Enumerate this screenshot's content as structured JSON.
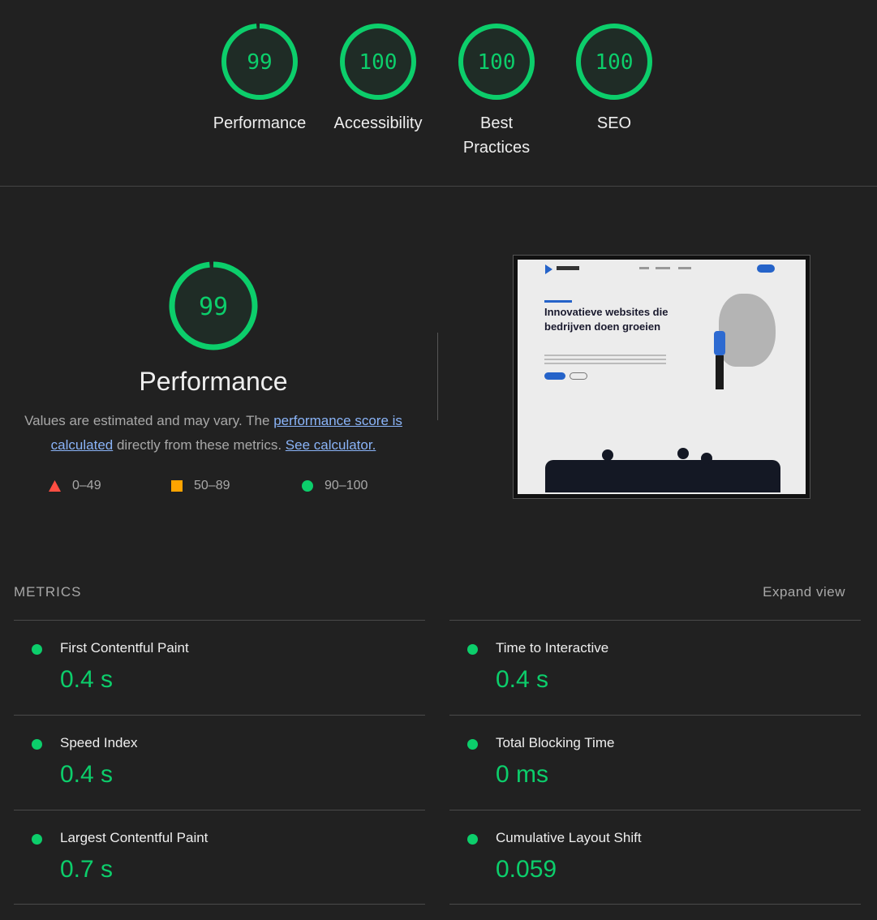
{
  "categories": [
    {
      "label": "Performance",
      "score": 99
    },
    {
      "label": "Accessibility",
      "score": 100
    },
    {
      "label": "Best Practices",
      "score": 100
    },
    {
      "label": "SEO",
      "score": 100
    }
  ],
  "performance": {
    "score": 99,
    "title": "Performance",
    "desc_1": "Values are estimated and may vary. The ",
    "link_score": "performance score is calculated",
    "desc_2": " directly from these metrics. ",
    "link_calc": "See calculator.",
    "legend": [
      {
        "range": "0–49",
        "color": "#ff4e42",
        "shape": "triangle"
      },
      {
        "range": "50–89",
        "color": "#ffa400",
        "shape": "square"
      },
      {
        "range": "90–100",
        "color": "#0cce6b",
        "shape": "circle"
      }
    ]
  },
  "thumbnail": {
    "headline": "Innovatieve websites die bedrijven doen groeien"
  },
  "metrics": {
    "header": "METRICS",
    "expand": "Expand view",
    "items": [
      {
        "label": "First Contentful Paint",
        "value": "0.4 s"
      },
      {
        "label": "Time to Interactive",
        "value": "0.4 s"
      },
      {
        "label": "Speed Index",
        "value": "0.4 s"
      },
      {
        "label": "Total Blocking Time",
        "value": "0 ms"
      },
      {
        "label": "Largest Contentful Paint",
        "value": "0.7 s"
      },
      {
        "label": "Cumulative Layout Shift",
        "value": "0.059"
      }
    ]
  },
  "colors": {
    "pass": "#0cce6b",
    "background": "#212121"
  }
}
